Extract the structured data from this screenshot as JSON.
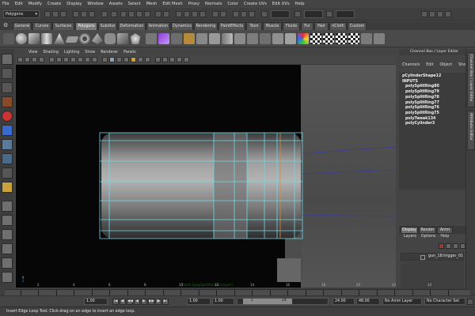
{
  "menubar": [
    "File",
    "Edit",
    "Modify",
    "Create",
    "Display",
    "Window",
    "Assets",
    "Select",
    "Mesh",
    "Edit Mesh",
    "Proxy",
    "Normals",
    "Color",
    "Create UVs",
    "Edit UVs",
    "Help"
  ],
  "statusline": {
    "mode": "Polygons"
  },
  "shelf_tabs": [
    "General",
    "Curves",
    "Surfaces",
    "Polygons",
    "Subdivs",
    "Deformation",
    "Animation",
    "Dynamics",
    "Rendering",
    "PaintEffects",
    "Toon",
    "Muscle",
    "Fluids",
    "Fur",
    "Hair",
    "nCloth",
    "Custom"
  ],
  "shelf_active": "Polygons",
  "viewport": {
    "menu": [
      "View",
      "Shading",
      "Lighting",
      "Show",
      "Renderer",
      "Panels"
    ],
    "hud": "front (polySplitRenderLayer)",
    "axis_y": "y",
    "axis_z": "z"
  },
  "channel_box": {
    "title": "Channel Box / Layer Editor",
    "menu": [
      "Channels",
      "Edit",
      "Object",
      "Show"
    ],
    "shape": "pCylinderShape12",
    "inputs_label": "INPUTS",
    "inputs": [
      "polySplitRing80",
      "polySplitRing79",
      "polySplitRing78",
      "polySplitRing77",
      "polySplitRing76",
      "polySplitRing75",
      "polyTweak134",
      "polyCylinder3"
    ]
  },
  "side_tabs": [
    "Channel Box / Layer Editor",
    "Attribute Editor"
  ],
  "layer_editor": {
    "tabs": [
      "Display",
      "Render",
      "Anim"
    ],
    "menu": [
      "Layers",
      "Options",
      "Help"
    ],
    "layer_name": "gun_18:trigger_01"
  },
  "timeline": {
    "tick_labels": [
      "2",
      "4",
      "6",
      "8",
      "10",
      "12",
      "14",
      "16",
      "18",
      "20",
      "22",
      "24"
    ],
    "start": "1.00",
    "current": "1.00",
    "range_start": "1.00",
    "slider_start": "1",
    "slider_end": "24",
    "end": "24.00",
    "range_end": "48.00",
    "anim_layer": "No Anim Layer",
    "char_set": "No Character Set",
    "play_buttons": [
      "|◀",
      "◀|",
      "◀◀",
      "◀",
      "▶",
      "▶▶",
      "|▶",
      "▶|"
    ]
  },
  "helpline": "Insert Edge Loop Tool: Click-drag on an edge to insert an edge loop."
}
